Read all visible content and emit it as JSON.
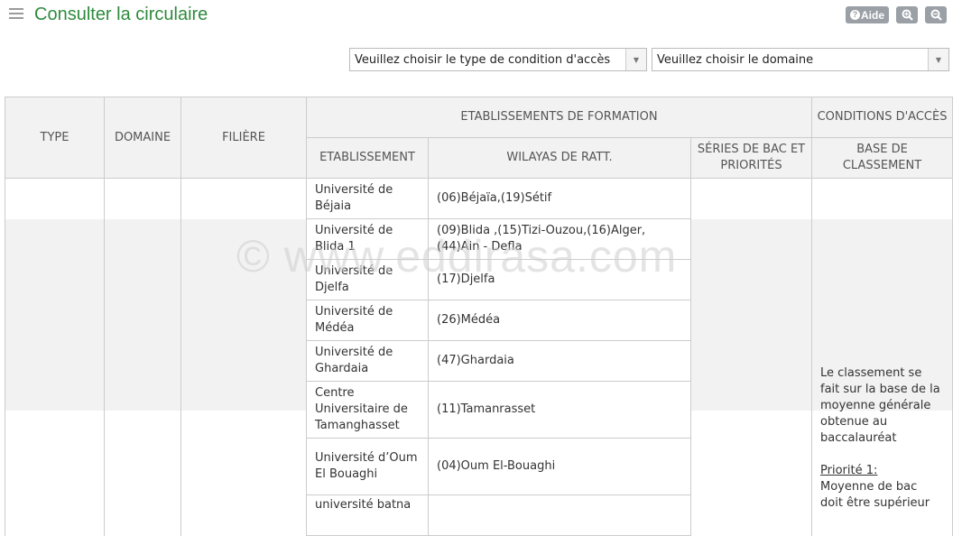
{
  "header": {
    "title": "Consulter la circulaire",
    "help_label": "Aide"
  },
  "filters": {
    "access_type": "Veuillez choisir le type de condition d'accès",
    "domain": "Veuillez choisir le domaine"
  },
  "table": {
    "headers": {
      "type": "TYPE",
      "domaine": "DOMAINE",
      "filiere": "FILIÈRE",
      "etab_formation": "ETABLISSEMENTS DE FORMATION",
      "conditions": "CONDITIONS D'ACCÈS",
      "etablissement": "ETABLISSEMENT",
      "wilayas": "WILAYAS DE RATT.",
      "series": "SÉRIES DE BAC ET PRIORITÉS",
      "base": "BASE DE CLASSEMENT"
    },
    "rows": [
      {
        "etab": "Université de Béjaia",
        "wilaya": "(06)Béjaïa,(19)Sétif"
      },
      {
        "etab": "Université de Blida 1",
        "wilaya": "(09)Blida ,(15)Tizi-Ouzou,(16)Alger, (44)Ain - Defla"
      },
      {
        "etab": "Université de Djelfa",
        "wilaya": "(17)Djelfa"
      },
      {
        "etab": "Université de Médéa",
        "wilaya": "(26)Médéa"
      },
      {
        "etab": "Université de Ghardaia",
        "wilaya": "(47)Ghardaia"
      },
      {
        "etab": "Centre Universitaire de Tamanghasset",
        "wilaya": "(11)Tamanrasset"
      },
      {
        "etab": "Université d’Oum El Bouaghi",
        "wilaya": "(04)Oum El-Bouaghi"
      },
      {
        "etab": "université batna",
        "wilaya": ""
      }
    ],
    "criteria_text": "Le classement se fait sur la base de la moyenne générale obtenue au baccalauréat",
    "priority_label": "Priorité 1:",
    "priority_text": "Moyenne de bac doit être supérieur"
  },
  "watermark": "© www.eddirasa.com"
}
